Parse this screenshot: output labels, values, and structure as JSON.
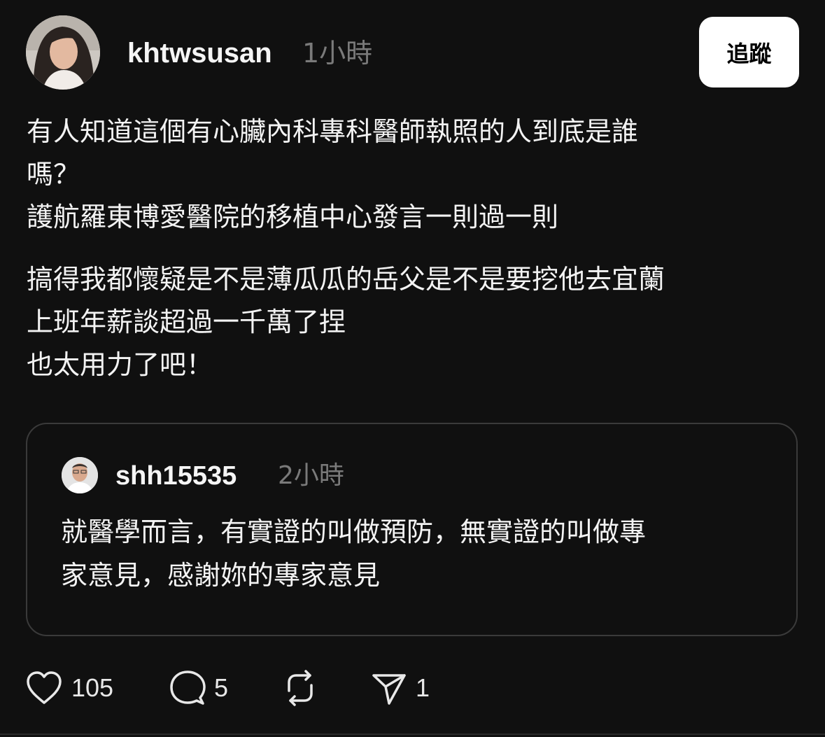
{
  "post": {
    "username": "khtwsusan",
    "time": "1小時",
    "follow_label": "追蹤",
    "lines": [
      "有人知道這個有心臟內科專科醫師執照的人到底是誰",
      "嗎？",
      "護航羅東博愛醫院的移植中心發言一則過一則",
      "搞得我都懷疑是不是薄瓜瓜的岳父是不是要挖他去宜蘭",
      "上班年薪談超過一千萬了捏",
      "也太用力了吧！"
    ]
  },
  "quoted": {
    "username": "shh15535",
    "time": "2小時",
    "lines": [
      "就醫學而言，有實證的叫做預防，無實證的叫做專",
      "家意見，感謝妳的專家意見"
    ]
  },
  "actions": {
    "likes": "105",
    "comments": "5",
    "shares": "1"
  },
  "colors": {
    "background": "#101010",
    "text": "#f3f3f3",
    "muted": "#7a7a7a",
    "button_bg": "#ffffff"
  }
}
